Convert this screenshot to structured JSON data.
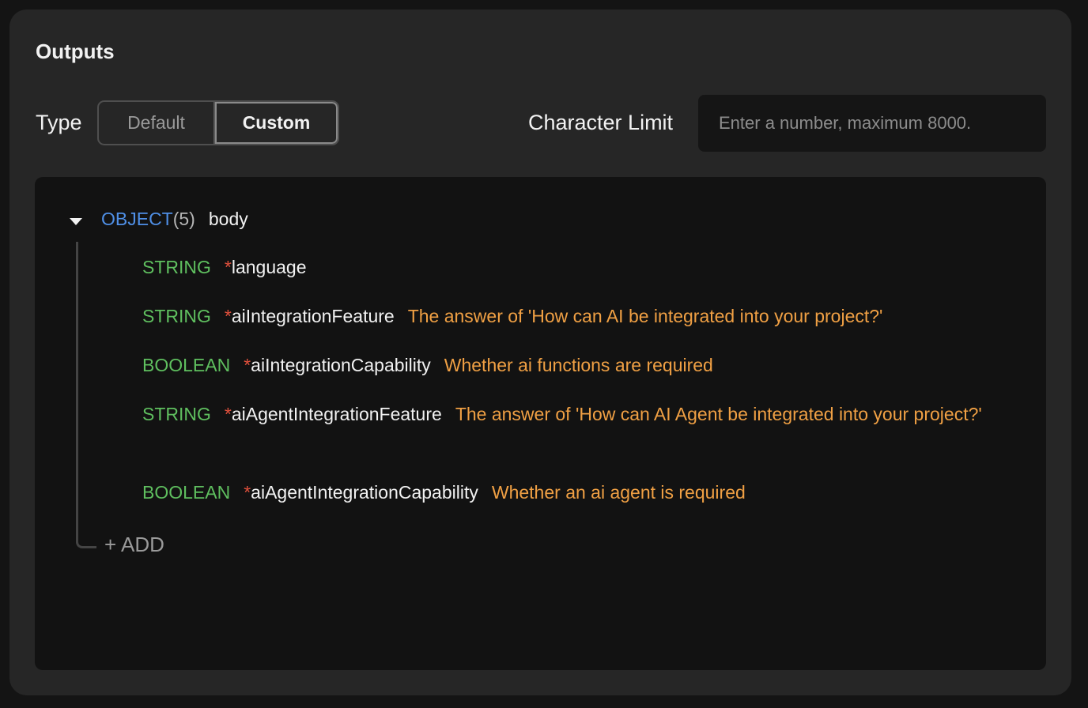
{
  "outputs": {
    "title": "Outputs"
  },
  "type_selector": {
    "label": "Type",
    "options": [
      "Default",
      "Custom"
    ],
    "selected": "Custom"
  },
  "character_limit": {
    "label": "Character Limit",
    "value": "",
    "placeholder": "Enter a number, maximum 8000."
  },
  "schema": {
    "root": {
      "type": "OBJECT",
      "count": "(5)",
      "name": "body",
      "expanded": true,
      "icon": "caret-down-icon"
    },
    "fields": [
      {
        "type": "STRING",
        "required_mark": "*",
        "name": "language",
        "description": ""
      },
      {
        "type": "STRING",
        "required_mark": "*",
        "name": "aiIntegrationFeature",
        "description": "The answer of 'How can AI be integrated into your project?'"
      },
      {
        "type": "BOOLEAN",
        "required_mark": "*",
        "name": "aiIntegrationCapability",
        "description": "Whether ai functions are required"
      },
      {
        "type": "STRING",
        "required_mark": "*",
        "name": "aiAgentIntegrationFeature",
        "description": "The answer of 'How can AI Agent be integrated into your project?'"
      },
      {
        "type": "BOOLEAN",
        "required_mark": "*",
        "name": "aiAgentIntegrationCapability",
        "description": "Whether an ai agent is required"
      }
    ],
    "add_label": "+ ADD"
  },
  "colors": {
    "object_type": "#4f8fe6",
    "field_type": "#5fbf5f",
    "required": "#e0503c",
    "description": "#f0a044"
  }
}
